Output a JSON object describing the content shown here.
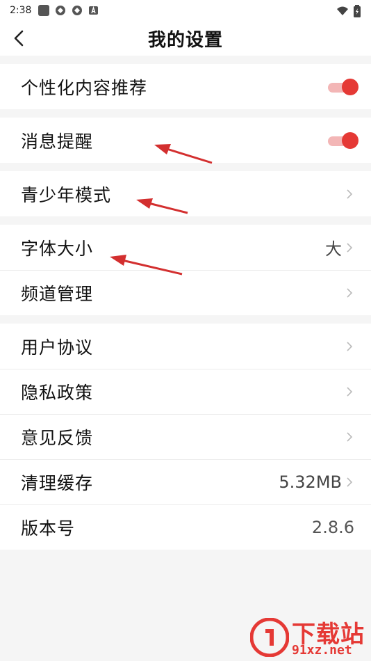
{
  "status_bar": {
    "time": "2:38"
  },
  "nav": {
    "title": "我的设置",
    "back_icon": "back-arrow-icon"
  },
  "groups": [
    {
      "rows": [
        {
          "label": "个性化内容推荐",
          "control": "toggle",
          "on": true
        }
      ]
    },
    {
      "rows": [
        {
          "label": "消息提醒",
          "control": "toggle",
          "on": true
        }
      ]
    },
    {
      "rows": [
        {
          "label": "青少年模式",
          "control": "chevron"
        }
      ]
    },
    {
      "rows": [
        {
          "label": "字体大小",
          "value": "大",
          "control": "chevron"
        },
        {
          "label": "频道管理",
          "control": "chevron"
        }
      ]
    },
    {
      "rows": [
        {
          "label": "用户协议",
          "control": "chevron"
        },
        {
          "label": "隐私政策",
          "control": "chevron"
        },
        {
          "label": "意见反馈",
          "control": "chevron"
        },
        {
          "label": "清理缓存",
          "value": "5.32MB",
          "control": "chevron"
        },
        {
          "label": "版本号",
          "value": "2.8.6",
          "control": "none"
        }
      ]
    }
  ],
  "watermark": {
    "title": "下载站",
    "url": "91xz.net"
  },
  "colors": {
    "accent": "#e53935",
    "toggle_track": "#f3b6b6",
    "background": "#f5f5f5"
  }
}
